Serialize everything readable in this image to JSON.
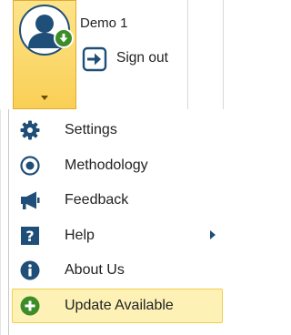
{
  "user": {
    "name": "Demo 1",
    "avatar_icon": "user-avatar-icon",
    "badge_icon": "download-badge-icon"
  },
  "signout": {
    "label": "Sign out",
    "icon": "sign-out-icon"
  },
  "menu": {
    "items": [
      {
        "label": "Settings",
        "icon": "gear-icon"
      },
      {
        "label": "Methodology",
        "icon": "radio-target-icon"
      },
      {
        "label": "Feedback",
        "icon": "megaphone-icon"
      },
      {
        "label": "Help",
        "icon": "question-icon",
        "has_submenu": true
      },
      {
        "label": "About Us",
        "icon": "info-icon"
      },
      {
        "label": "Update Available",
        "icon": "plus-circle-icon",
        "highlighted": true
      }
    ]
  },
  "colors": {
    "selected_button_fill": "#f9cf55",
    "selected_button_border": "#e3a92e",
    "icon_navy": "#1f4e79",
    "update_green": "#3c8c28",
    "highlight_fill": "#fdf1b6",
    "highlight_border": "#f3cd4c"
  }
}
